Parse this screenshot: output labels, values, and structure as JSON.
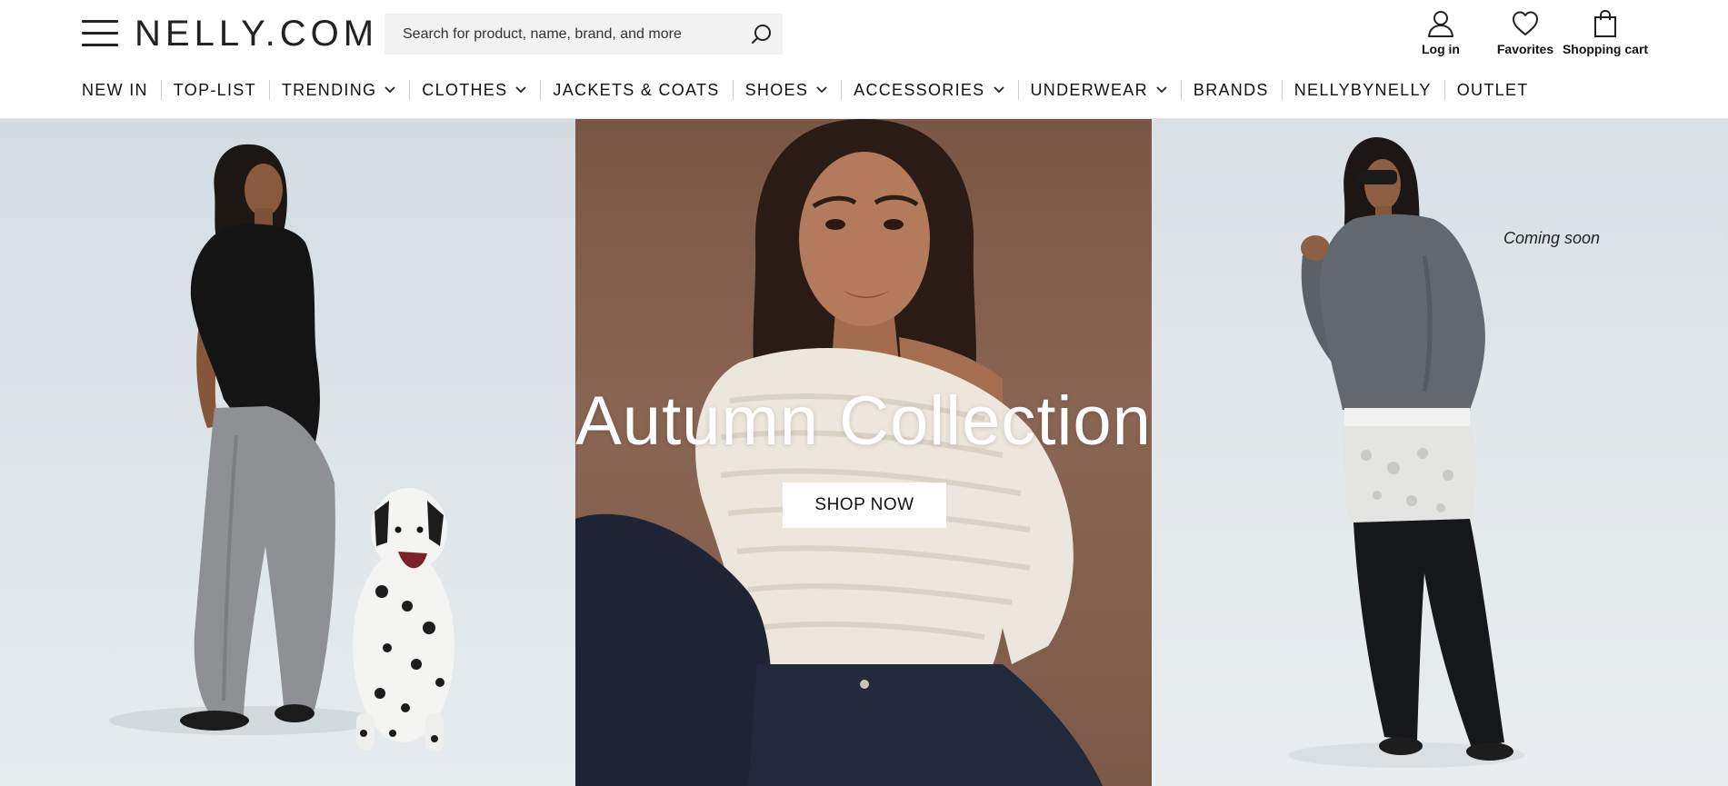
{
  "header": {
    "logo": "NELLY.COM",
    "search_placeholder": "Search for product, name, brand, and more",
    "login_label": "Log in",
    "favorites_label": "Favorites",
    "cart_label": "Shopping cart"
  },
  "nav": {
    "items": [
      {
        "label": "NEW IN",
        "dropdown": false
      },
      {
        "label": "TOP-LIST",
        "dropdown": false
      },
      {
        "label": "TRENDING",
        "dropdown": true
      },
      {
        "label": "CLOTHES",
        "dropdown": true
      },
      {
        "label": "JACKETS & COATS",
        "dropdown": false
      },
      {
        "label": "SHOES",
        "dropdown": true
      },
      {
        "label": "ACCESSORIES",
        "dropdown": true
      },
      {
        "label": "UNDERWEAR",
        "dropdown": true
      },
      {
        "label": "BRANDS",
        "dropdown": false
      },
      {
        "label": "NELLYBYNELLY",
        "dropdown": false
      },
      {
        "label": "OUTLET",
        "dropdown": false
      }
    ]
  },
  "hero": {
    "title": "Autumn Collection",
    "cta_label": "SHOP NOW",
    "right_panel_caption": "Coming soon"
  },
  "colors": {
    "text": "#111111",
    "search_bg": "#f2f2f2",
    "mid_panel_bg": "#7a5644",
    "side_panel_bg": "#dfe6ea"
  }
}
